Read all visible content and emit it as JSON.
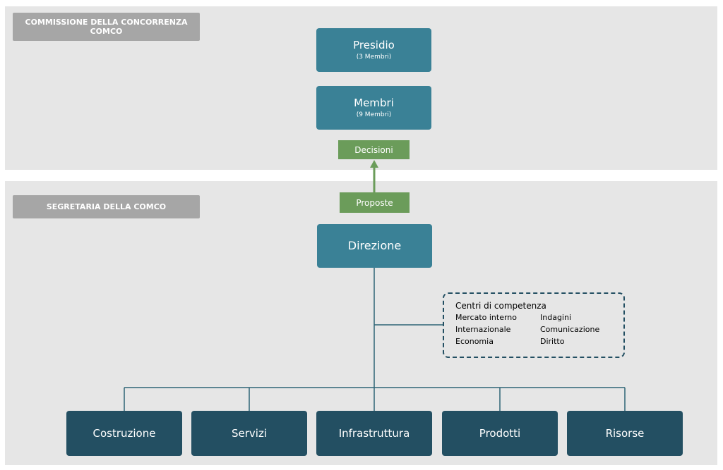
{
  "sections": {
    "commissione": "COMMISSIONE DELLA CONCORRENZA COMCO",
    "segretaria": "SEGRETARIA DELLA COMCO"
  },
  "boxes": {
    "presidio": {
      "title": "Presidio",
      "subtitle": "(3 Membri)"
    },
    "membri": {
      "title": "Membri",
      "subtitle": "(9 Membri)"
    },
    "direzione": {
      "title": "Direzione"
    }
  },
  "tags": {
    "decisioni": "Decisioni",
    "proposte": "Proposte"
  },
  "competence": {
    "title": "Centri di competenza",
    "items": [
      "Mercato interno",
      "Indagini",
      "Internazionale",
      "Comunicazione",
      "Economia",
      "Diritto"
    ]
  },
  "departments": [
    "Costruzione",
    "Servizi",
    "Infrastruttura",
    "Prodotti",
    "Risorse"
  ],
  "colors": {
    "band": "#e6e6e6",
    "section_label": "#a6a6a6",
    "teal_box": "#3a8196",
    "dark_box": "#234f62",
    "green_tag": "#6b9c5a",
    "connector": "#2f6576"
  }
}
